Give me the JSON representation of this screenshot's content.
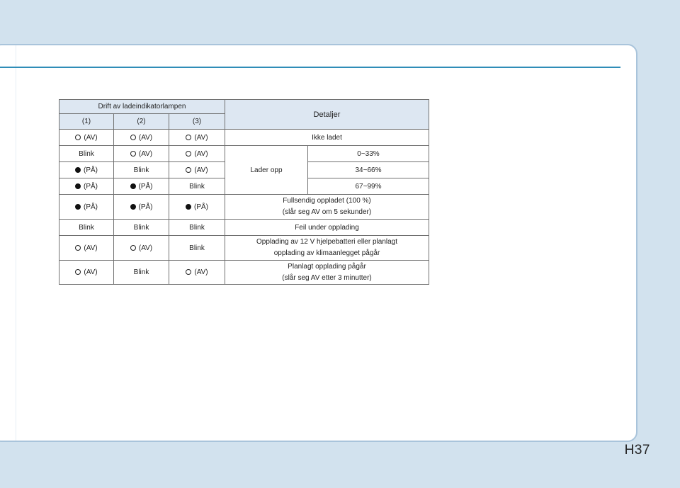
{
  "page_number": "H37",
  "table": {
    "header_main": "Drift av ladeindikatorlampen",
    "header_details": "Detaljer",
    "col1": "(1)",
    "col2": "(2)",
    "col3": "(3)",
    "row1": {
      "c1": "(AV)",
      "c2": "(AV)",
      "c3": "(AV)",
      "detail": "Ikke ladet"
    },
    "row2": {
      "c1": "Blink",
      "c2": "(AV)",
      "c3": "(AV)",
      "group": "Lader opp",
      "detail": "0~33%"
    },
    "row3": {
      "c1": "(PÅ)",
      "c2": "Blink",
      "c3": "(AV)",
      "detail": "34~66%"
    },
    "row4": {
      "c1": "(PÅ)",
      "c2": "(PÅ)",
      "c3": "Blink",
      "detail": "67~99%"
    },
    "row5": {
      "c1": "(PÅ)",
      "c2": "(PÅ)",
      "c3": "(PÅ)",
      "detail_line1": "Fullsendig oppladet (100 %)",
      "detail_line2": "(slår seg AV om 5 sekunder)"
    },
    "row6": {
      "c1": "Blink",
      "c2": "Blink",
      "c3": "Blink",
      "detail": "Feil under opplading"
    },
    "row7": {
      "c1": "(AV)",
      "c2": "(AV)",
      "c3": "Blink",
      "detail_line1": "Opplading av 12 V hjelpebatteri eller planlagt",
      "detail_line2": "opplading av klimaanlegget pågår"
    },
    "row8": {
      "c1": "(AV)",
      "c2": "Blink",
      "c3": "(AV)",
      "detail_line1": "Planlagt opplading pågår",
      "detail_line2": "(slår seg AV etter 3 minutter)"
    }
  },
  "icons": {
    "off": "open-circle-icon",
    "on": "filled-circle-icon"
  }
}
